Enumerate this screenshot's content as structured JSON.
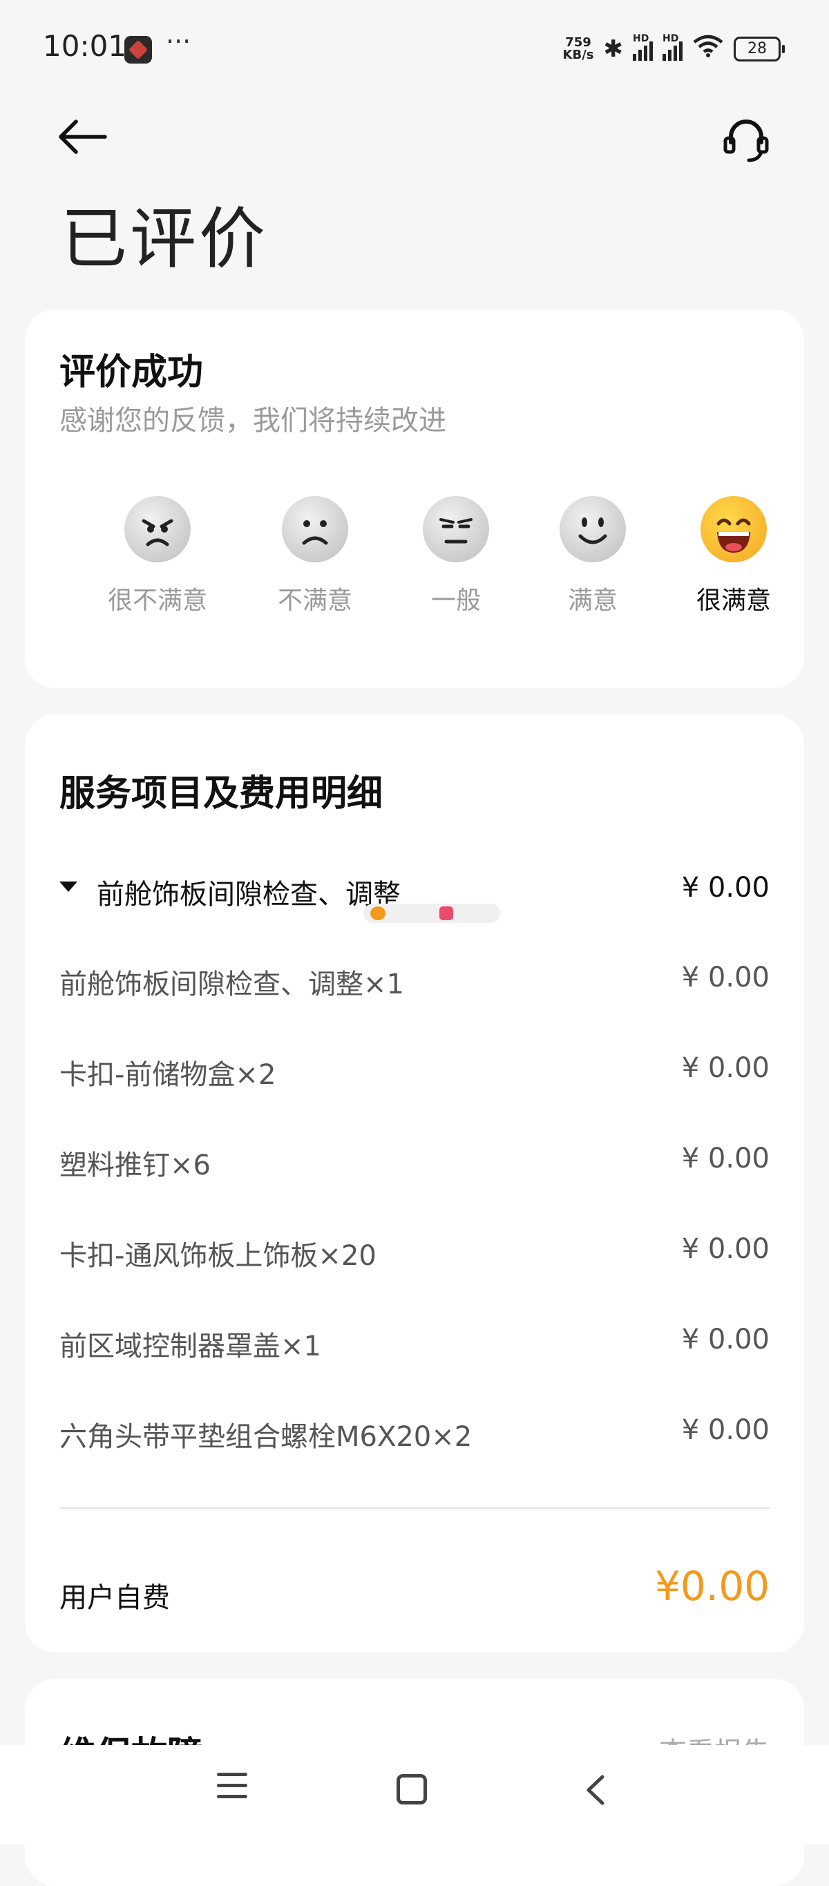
{
  "status_bar": {
    "time": "10:01",
    "more": "···",
    "net_speed_value": "759",
    "net_speed_unit": "KB/s",
    "signal_tag": "HD",
    "battery": "28"
  },
  "header": {
    "title": "已评价"
  },
  "rating_card": {
    "heading": "评价成功",
    "subtitle": "感谢您的反馈，我们将持续改进",
    "options": [
      {
        "label": "很不满意",
        "icon": "very-dissatisfied-face-icon"
      },
      {
        "label": "不满意",
        "icon": "dissatisfied-face-icon"
      },
      {
        "label": "一般",
        "icon": "neutral-face-icon"
      },
      {
        "label": "满意",
        "icon": "satisfied-face-icon"
      },
      {
        "label": "很满意",
        "icon": "very-satisfied-face-icon"
      }
    ],
    "selected": "很满意",
    "selected_color": "#f5a623"
  },
  "detail_card": {
    "heading": "服务项目及费用明细",
    "group": {
      "name": "前舱饰板间隙检查、调整",
      "price": "¥ 0.00"
    },
    "items": [
      {
        "name": "前舱饰板间隙检查、调整×1",
        "price": "¥ 0.00"
      },
      {
        "name": "卡扣-前储物盒×2",
        "price": "¥ 0.00"
      },
      {
        "name": "塑料推钉×6",
        "price": "¥ 0.00"
      },
      {
        "name": "卡扣-通风饰板上饰板×20",
        "price": "¥ 0.00"
      },
      {
        "name": "前区域控制器罩盖×1",
        "price": "¥ 0.00"
      },
      {
        "name": "六角头带平垫组合螺栓M6X20×2",
        "price": "¥ 0.00"
      }
    ],
    "self_pay_label": "用户自费",
    "self_pay_value": "¥0.00",
    "accent_color": "#f39a1d"
  },
  "repair_card": {
    "heading": "维保故障",
    "link": "查看报告"
  }
}
